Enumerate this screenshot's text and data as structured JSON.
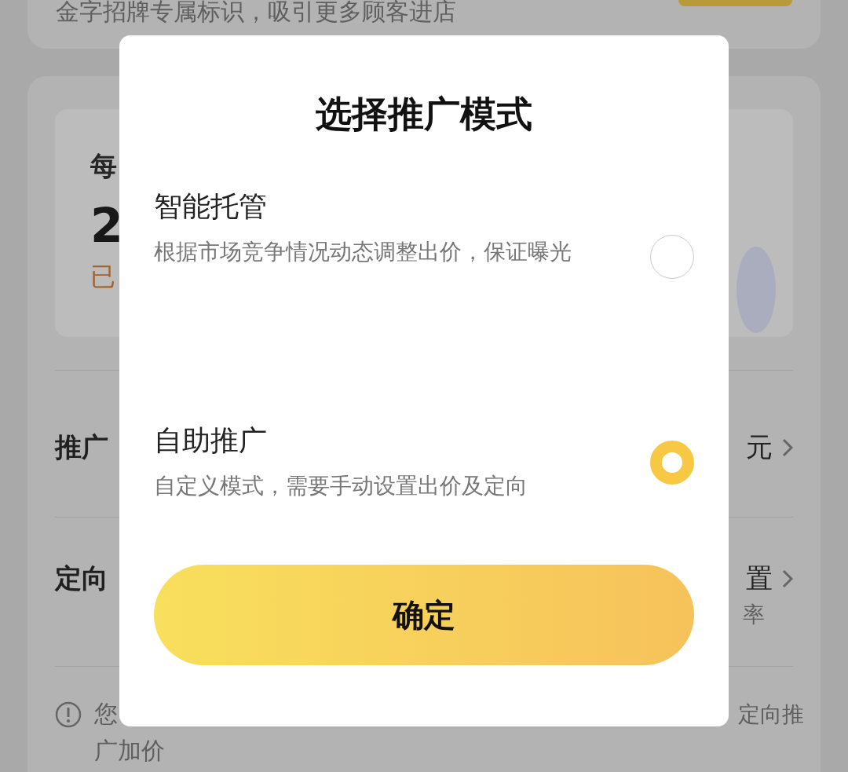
{
  "background": {
    "banner_text": "金字招牌专属标识，吸引更多顾客进店",
    "budget_label": "每",
    "budget_value": "2",
    "budget_note": "已",
    "rows": [
      {
        "label": "推广",
        "value": "元"
      },
      {
        "label": "定向",
        "value": "置",
        "note": "率"
      }
    ],
    "notice": {
      "line1_start": "您",
      "line1_end": "定向推",
      "line2": "广加价"
    }
  },
  "dialog": {
    "title": "选择推广模式",
    "options": [
      {
        "title": "智能托管",
        "description": "根据市场竞争情况动态调整出价，保证曝光",
        "selected": false
      },
      {
        "title": "自助推广",
        "description": "自定义模式，需要手动设置出价及定向",
        "selected": true
      }
    ],
    "confirm": "确定"
  }
}
